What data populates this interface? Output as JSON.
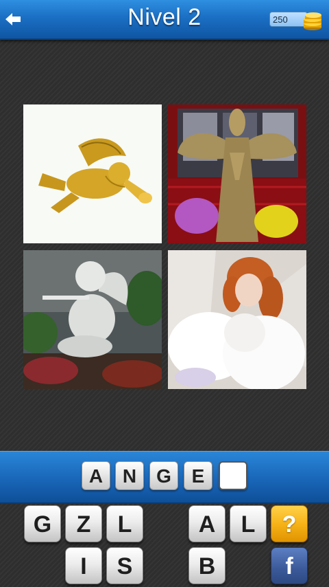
{
  "header": {
    "back_icon": "back-arrow-icon",
    "title": "Nivel 2",
    "coins": "250",
    "coin_icon": "coin-stack-icon"
  },
  "puzzle": {
    "images": [
      "golden-cherub-ornament",
      "straw-angel-sculpture",
      "stone-cherub-statue",
      "angel-doll"
    ],
    "answer_slots": [
      "A",
      "N",
      "G",
      "E",
      ""
    ]
  },
  "keyboard": {
    "row1": [
      "G",
      "Z",
      "L",
      "",
      "A",
      "L"
    ],
    "row2": [
      "",
      "I",
      "S",
      "",
      "B",
      ""
    ],
    "hint_label": "?",
    "facebook_label": "f"
  },
  "colors": {
    "header_blue": "#1b6fc4",
    "hint_orange": "#f7b318",
    "facebook_blue": "#3b5998"
  }
}
